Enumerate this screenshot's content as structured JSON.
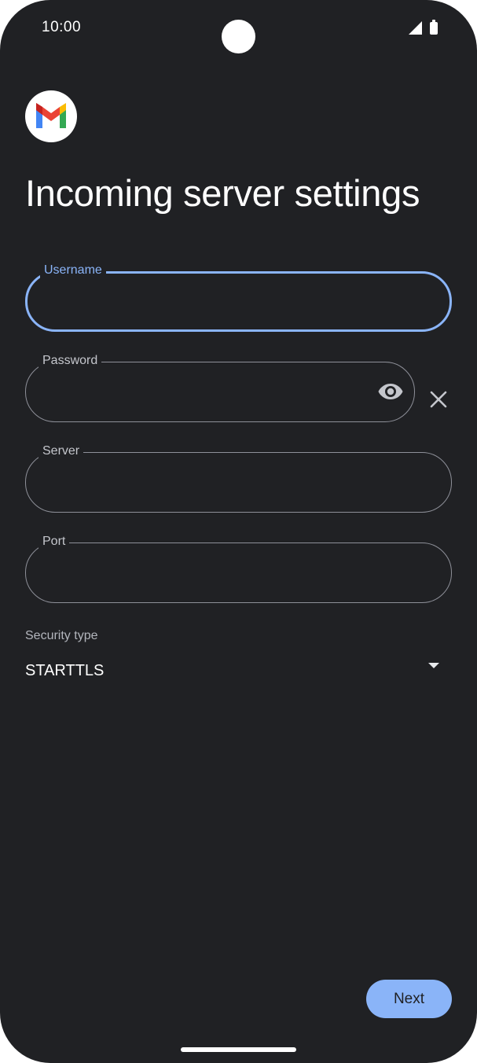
{
  "status_bar": {
    "time": "10:00",
    "icons": [
      "signal-icon",
      "battery-icon"
    ]
  },
  "app": {
    "logo_icon": "gmail-logo-icon"
  },
  "page": {
    "title": "Incoming server settings"
  },
  "form": {
    "username": {
      "label": "Username",
      "value": "",
      "focused": true
    },
    "password": {
      "label": "Password",
      "value": "",
      "trailing_icon": "eye-icon"
    },
    "server": {
      "label": "Server",
      "value": ""
    },
    "port": {
      "label": "Port",
      "value": ""
    },
    "security_type": {
      "label": "Security type",
      "selected": "STARTTLS",
      "icon": "dropdown-arrow-icon"
    }
  },
  "actions": {
    "next_label": "Next"
  },
  "colors": {
    "background": "#202124",
    "accent": "#8ab4f8",
    "outline": "#8e9099",
    "text_primary": "#ffffff",
    "text_secondary": "#c4c6cc"
  }
}
